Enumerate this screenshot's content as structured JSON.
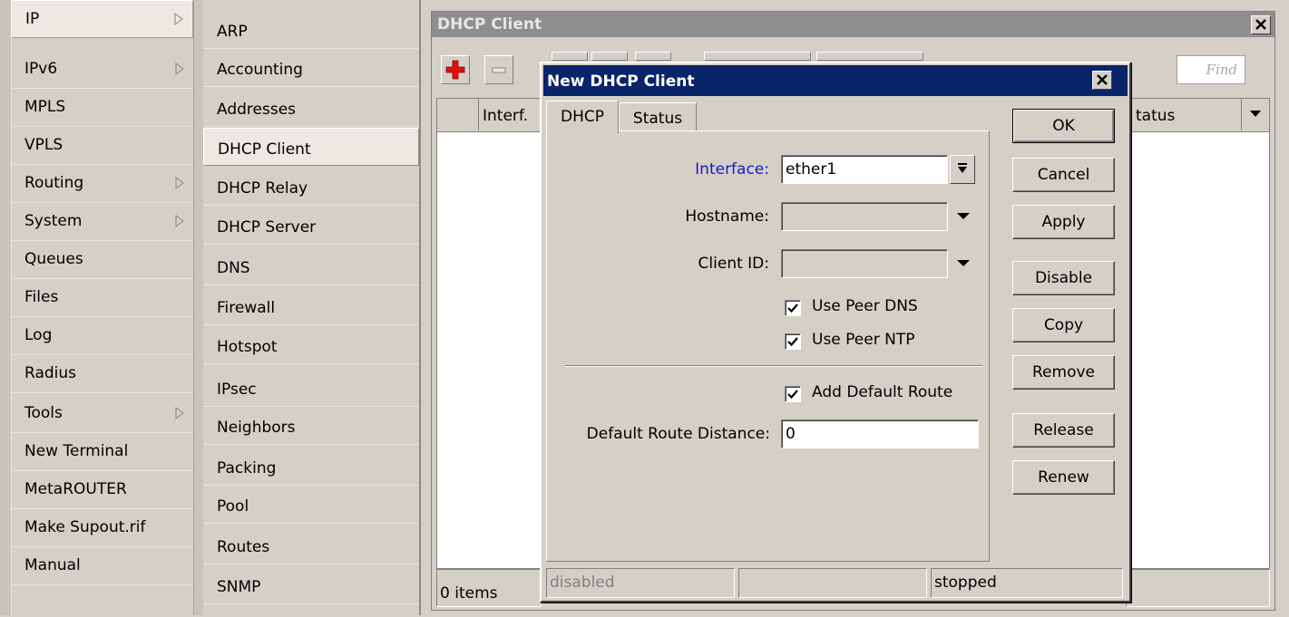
{
  "left_menu": {
    "items": [
      {
        "label": "IP",
        "submenu": true,
        "selected": true
      },
      {
        "label": "IPv6",
        "submenu": true
      },
      {
        "label": "MPLS"
      },
      {
        "label": "VPLS"
      },
      {
        "label": "Routing",
        "submenu": true
      },
      {
        "label": "System",
        "submenu": true
      },
      {
        "label": "Queues"
      },
      {
        "label": "Files"
      },
      {
        "label": "Log"
      },
      {
        "label": "Radius"
      },
      {
        "label": "Tools",
        "submenu": true
      },
      {
        "label": "New Terminal"
      },
      {
        "label": "MetaROUTER"
      },
      {
        "label": "Make Supout.rif"
      },
      {
        "label": "Manual"
      }
    ]
  },
  "sub_menu": {
    "items": [
      {
        "label": "ARP"
      },
      {
        "label": "Accounting"
      },
      {
        "label": "Addresses"
      },
      {
        "label": "DHCP Client",
        "selected": true
      },
      {
        "label": "DHCP Relay"
      },
      {
        "label": "DHCP Server"
      },
      {
        "label": "DNS"
      },
      {
        "label": "Firewall"
      },
      {
        "label": "Hotspot"
      },
      {
        "label": "IPsec"
      },
      {
        "label": "Neighbors"
      },
      {
        "label": "Packing"
      },
      {
        "label": "Pool"
      },
      {
        "label": "Routes"
      },
      {
        "label": "SNMP"
      }
    ]
  },
  "dhcp_window": {
    "title": "DHCP Client",
    "find_placeholder": "Find",
    "columns": {
      "interface": "Interf.",
      "status": "tatus"
    },
    "item_count": "0 items"
  },
  "dialog": {
    "title": "New DHCP Client",
    "tabs": [
      "DHCP",
      "Status"
    ],
    "fields": {
      "interface": {
        "label": "Interface:",
        "value": "ether1"
      },
      "hostname": {
        "label": "Hostname:",
        "value": ""
      },
      "client_id": {
        "label": "Client ID:",
        "value": ""
      },
      "default_route_distance": {
        "label": "Default Route Distance:",
        "value": "0"
      }
    },
    "checkboxes": {
      "use_peer_dns": {
        "label": "Use Peer DNS",
        "checked": true
      },
      "use_peer_ntp": {
        "label": "Use Peer NTP",
        "checked": true
      },
      "add_default_route": {
        "label": "Add Default Route",
        "checked": true
      }
    },
    "buttons": {
      "ok": "OK",
      "cancel": "Cancel",
      "apply": "Apply",
      "disable": "Disable",
      "copy": "Copy",
      "remove": "Remove",
      "release": "Release",
      "renew": "Renew"
    },
    "status": {
      "state": "disabled",
      "middle": "",
      "run": "stopped"
    }
  },
  "colors": {
    "window_bg": "#d4d0c8",
    "dialog_title": "#0a246a",
    "inactive_title": "#8e8e8e",
    "add_icon": "#e01010",
    "link_label": "#1a1ac4"
  },
  "icons": {
    "submenu": "triangle-right-icon",
    "add": "plus-icon",
    "remove": "minus-icon",
    "close": "close-x-icon",
    "dropdown": "triangle-down-icon",
    "combo": "combo-arrow-icon",
    "check": "check-icon"
  }
}
